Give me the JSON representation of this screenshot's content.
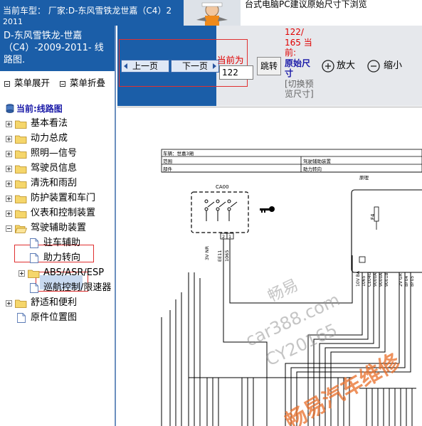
{
  "topbar": {
    "car_type_label": "当前车型：  厂家:D-东风雪铁龙世嘉（C4）2",
    "car_type_year": "2011",
    "promo_text": "台式电脑PC建议原始尺寸下浏览"
  },
  "left": {
    "model_title": "D-东风雪铁龙-世嘉（C4）-2009-2011- 线路图.",
    "menu_expand": "菜单展开",
    "menu_collapse": "菜单折叠",
    "current_path": "当前:线路图",
    "tree": [
      {
        "label": "基本看法",
        "toggle": "+"
      },
      {
        "label": "动力总成",
        "toggle": "+"
      },
      {
        "label": "照明—信号",
        "toggle": "+"
      },
      {
        "label": "驾驶员信息",
        "toggle": "+"
      },
      {
        "label": "清洗和雨刮",
        "toggle": "+"
      },
      {
        "label": "防护装置和车门",
        "toggle": "+"
      },
      {
        "label": "仪表和控制装置",
        "toggle": "+"
      },
      {
        "label": "驾驶辅助装置",
        "toggle": "-"
      },
      {
        "label": "驻车辅助",
        "toggle": ""
      },
      {
        "label": "助力转向",
        "toggle": ""
      },
      {
        "label": "ABS/ASR/ESP",
        "toggle": "+"
      },
      {
        "label": "巡航控制/限速器",
        "toggle": ""
      },
      {
        "label": "舒适和便利",
        "toggle": "+"
      },
      {
        "label": "原件位置图",
        "toggle": ""
      }
    ]
  },
  "toolbar": {
    "prev_label": "上一页",
    "next_label": "下一页",
    "current_label": "当前为",
    "page_value": "122",
    "jump_label": "跳转",
    "page_count": "122/\n165",
    "current_word": "当前:",
    "orig_size_label": "原始尺寸",
    "switch_hint": "[切换预览尺寸]",
    "zoom_in_label": "放大",
    "zoom_out_label": "缩小"
  },
  "diagram": {
    "vehicle_label": "车辆：世嘉3厢",
    "range_label": "范围",
    "range_value": "驾驶辅助装置",
    "part_label": "部件",
    "part_value": "助力转向",
    "principle_label": "原理",
    "connector_name": "CA00",
    "pin_labels": [
      "2",
      "1"
    ],
    "wire_codes": [
      "3V NR",
      "EE11",
      "1065"
    ],
    "right_wire_codes": [
      "10V BA",
      "1065",
      "CE04G",
      "9000A",
      "9000A",
      "9001B"
    ],
    "right_wire_codes_2": [
      "2V GR",
      "BF04",
      "BF05"
    ],
    "fuse_label": "F4",
    "watermarks": [
      "畅易",
      "car388.com",
      "CY20165",
      "畅易汽车维修"
    ]
  }
}
